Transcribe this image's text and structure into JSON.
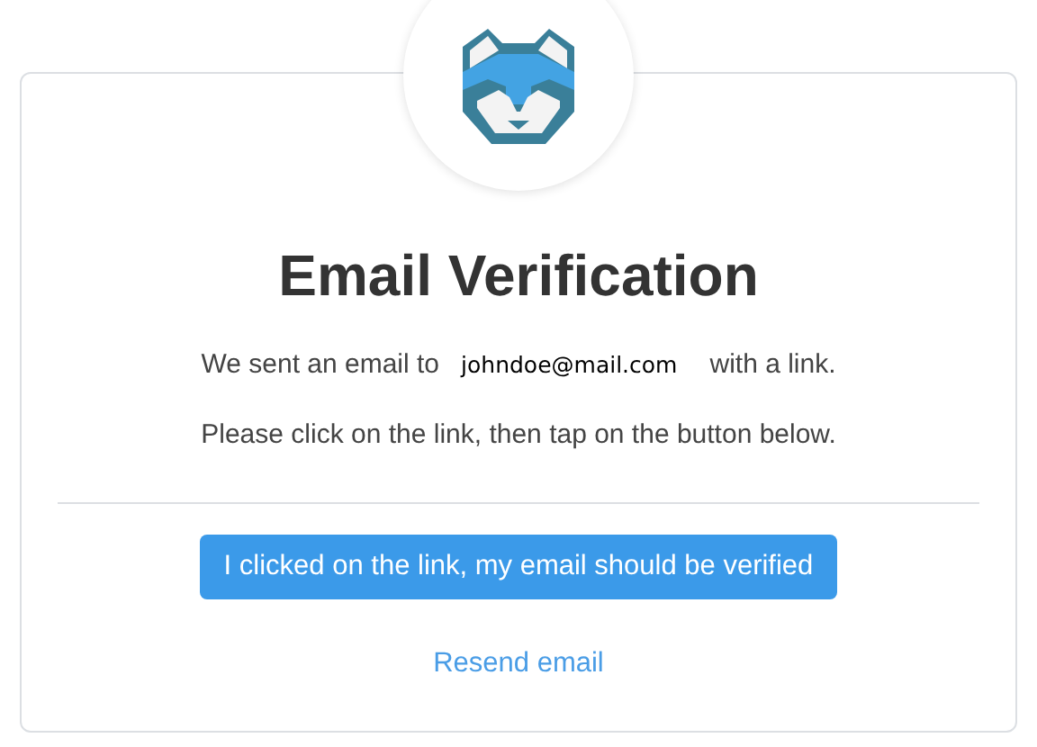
{
  "title": "Email Verification",
  "message": {
    "before": "We sent an email to",
    "email": "johndoe@mail.com",
    "after": "with a link."
  },
  "instruction": "Please click on the link, then tap on the button below.",
  "confirm_button": "I clicked on the link, my email should be verified",
  "resend_link": "Resend email"
}
